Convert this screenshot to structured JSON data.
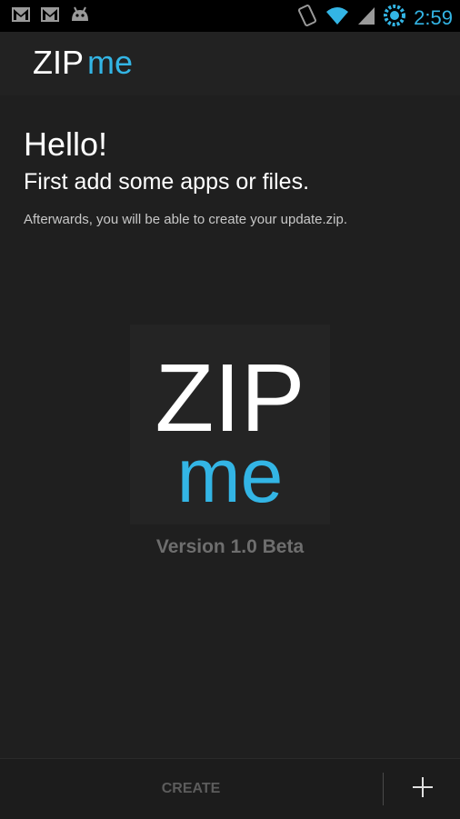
{
  "statusbar": {
    "time": "2:59",
    "icons": [
      "gmail-icon",
      "gmail-icon",
      "android-icon",
      "vibrate-icon",
      "wifi-icon",
      "signal-icon",
      "battery-icon"
    ]
  },
  "actionbar": {
    "logo": {
      "zip": "ZIP",
      "me": "me"
    }
  },
  "content": {
    "hello": "Hello!",
    "subtitle": "First add some apps or files.",
    "description": "Afterwards, you will be able to create your update.zip.",
    "big_logo": {
      "zip": "ZIP",
      "me": "me"
    },
    "version": "Version 1.0 Beta"
  },
  "bottombar": {
    "create_label": "CREATE",
    "add_icon": "plus-icon"
  },
  "colors": {
    "accent": "#33b5e5",
    "background": "#1f1f1f",
    "statusbar": "#000000"
  }
}
